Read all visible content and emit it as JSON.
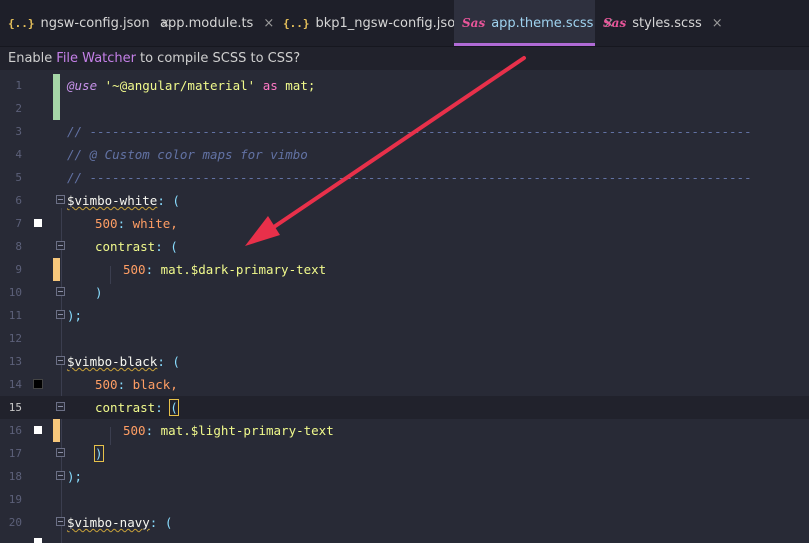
{
  "tabs": [
    {
      "icon": "json-icon",
      "label": "ngsw-config.json",
      "active": false
    },
    {
      "icon": "angular-icon",
      "label": "app.module.ts",
      "active": false
    },
    {
      "icon": "json-icon",
      "label": "bkp1_ngsw-config.json",
      "active": false
    },
    {
      "icon": "sass-icon",
      "label": "app.theme.scss",
      "active": true
    },
    {
      "icon": "sass-icon",
      "label": "styles.scss",
      "active": false
    }
  ],
  "json_icon_glyph": "{..}",
  "sass_icon_glyph": "Sas",
  "close_glyph": "×",
  "notice": {
    "prefix": "Enable",
    "link": "File Watcher",
    "suffix": "to compile SCSS to CSS?"
  },
  "line_numbers": [
    "1",
    "2",
    "3",
    "4",
    "5",
    "6",
    "7",
    "8",
    "9",
    "10",
    "11",
    "12",
    "13",
    "14",
    "15",
    "16",
    "17",
    "18",
    "19",
    "20"
  ],
  "current_line": 15,
  "code": {
    "l1_use": "@use",
    "l1_str": "'~@angular/material'",
    "l1_as": "as",
    "l1_mat": "mat;",
    "l3": "// ----------------------------------------------------------------------------------------",
    "l4": "// @ Custom color maps for vimbo",
    "l5": "// ----------------------------------------------------------------------------------------",
    "l6_var": "$vimbo-white",
    "l6_rest": ": (",
    "l7_key": "500",
    "l7_val": "white,",
    "l8_key": "contrast",
    "l8_rest": ": (",
    "l9_key": "500",
    "l9_val": "mat.$dark-primary-text",
    "l10": ")",
    "l11": ");",
    "l13_var": "$vimbo-black",
    "l13_rest": ": (",
    "l14_key": "500",
    "l14_val": "black,",
    "l15_key": "contrast",
    "l15_colon": ":",
    "l15_paren": "(",
    "l16_key": "500",
    "l16_val": "mat.$light-primary-text",
    "l17": ")",
    "l18": ");",
    "l20_var": "$vimbo-navy",
    "l20_rest": ": ("
  },
  "colors": {
    "white_swatch": "#ffffff",
    "black_swatch": "#000000",
    "added_marker": "#a5d6a7",
    "modified_marker": "#f7c77b",
    "arrow": "#e8304a"
  }
}
